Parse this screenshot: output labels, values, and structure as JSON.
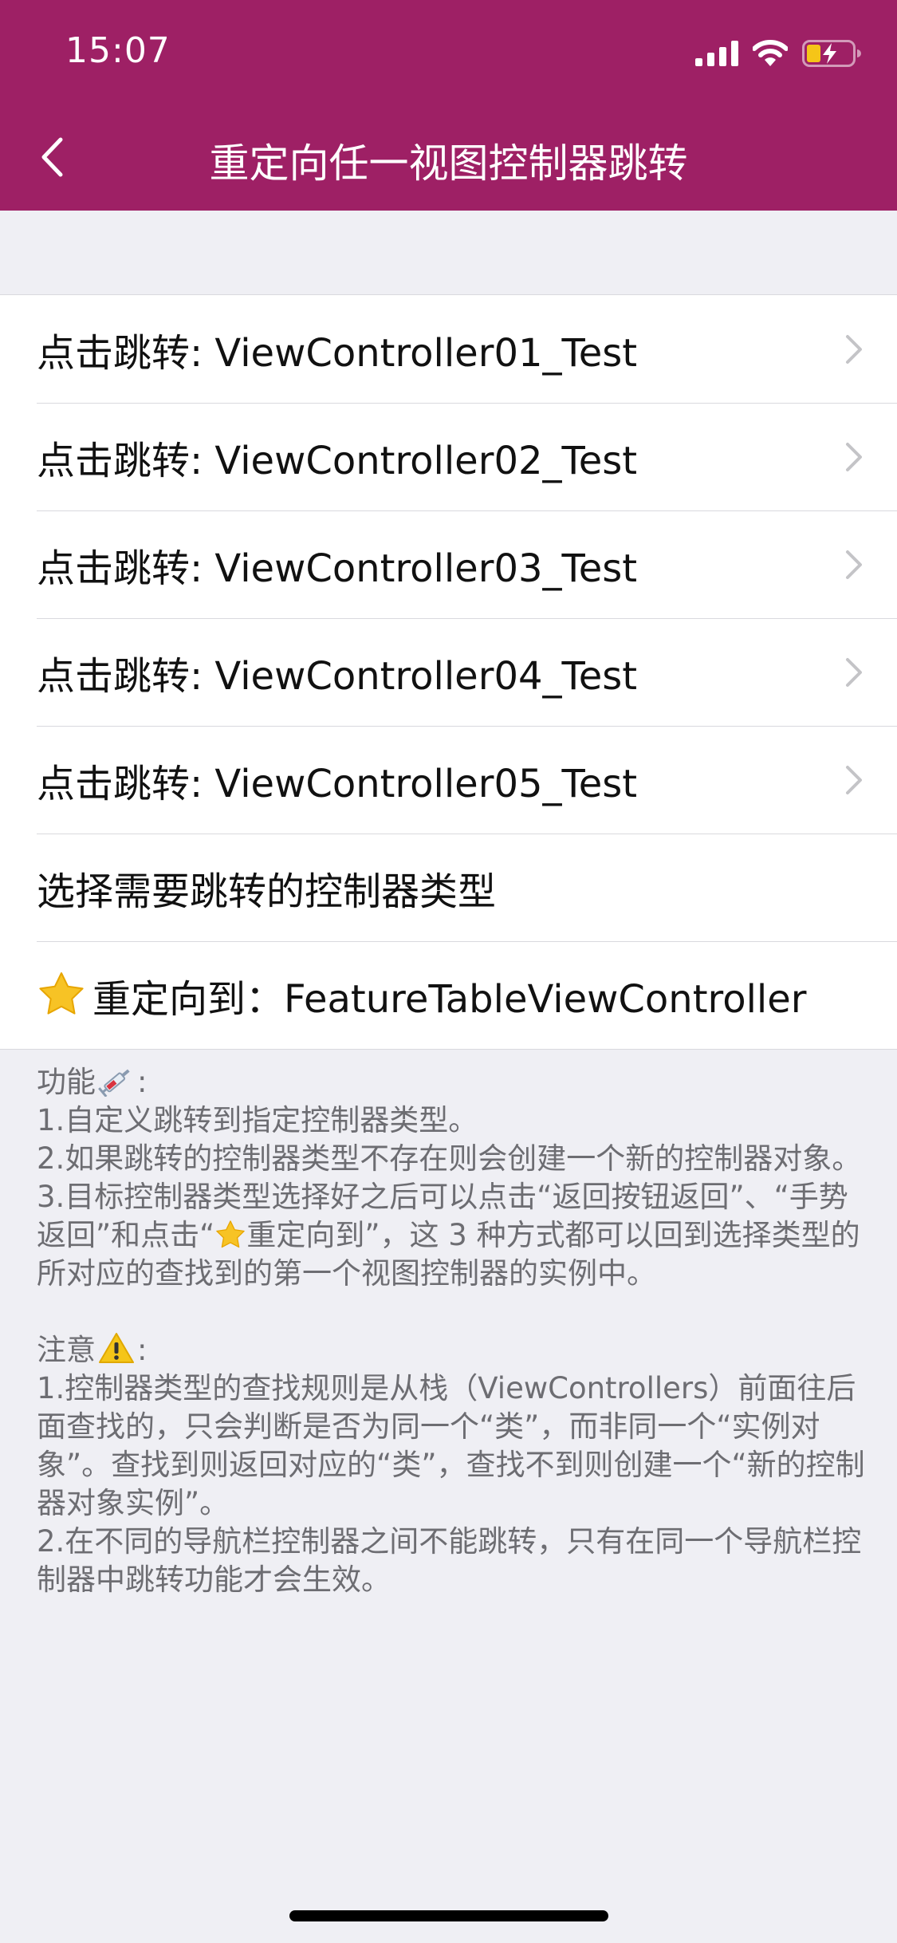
{
  "colors": {
    "nav_bar": "#9E2065",
    "background": "#EFEFF4",
    "cell": "#FFFFFF",
    "star": "#F7C325",
    "warning": "#F5C518"
  },
  "status_bar": {
    "time": "15:07",
    "icons": [
      "cellular-signal-icon",
      "wifi-icon",
      "battery-charging-icon"
    ]
  },
  "nav": {
    "back_icon": "chevron-left-icon",
    "title": "重定向任一视图控制器跳转"
  },
  "rows": [
    {
      "label": "点击跳转: ViewController01_Test",
      "chevron": true
    },
    {
      "label": "点击跳转: ViewController02_Test",
      "chevron": true
    },
    {
      "label": "点击跳转: ViewController03_Test",
      "chevron": true
    },
    {
      "label": "点击跳转: ViewController04_Test",
      "chevron": true
    },
    {
      "label": "点击跳转: ViewController05_Test",
      "chevron": true
    },
    {
      "label": "选择需要跳转的控制器类型",
      "chevron": false
    },
    {
      "label": "重定向到：FeatureTableViewController",
      "icon": "star-icon",
      "chevron": false
    }
  ],
  "notes": {
    "feature_title": "功能",
    "feature_icon": "syringe-icon",
    "feature_lines": [
      "1.自定义跳转到指定控制器类型。",
      "2.如果跳转的控制器类型不存在则会创建一个新的控制器对象。",
      "3.目标控制器类型选择好之后可以点击“返回按钮返回”、“手势返回”和点击“",
      "重定向到”，这 3 种方式都可以回到选择类型的所对应的查找到的第一个视图控制器的实例中。"
    ],
    "notice_title": "注意",
    "notice_icon": "warning-icon",
    "notice_lines": [
      "1.控制器类型的查找规则是从栈（ViewControllers）前面往后面查找的，只会判断是否为同一个“类”，而非同一个“实例对象”。查找到则返回对应的“类”，查找不到则创建一个“新的控制器对象实例”。",
      "2.在不同的导航栏控制器之间不能跳转，只有在同一个导航栏控制器中跳转功能才会生效。"
    ]
  }
}
